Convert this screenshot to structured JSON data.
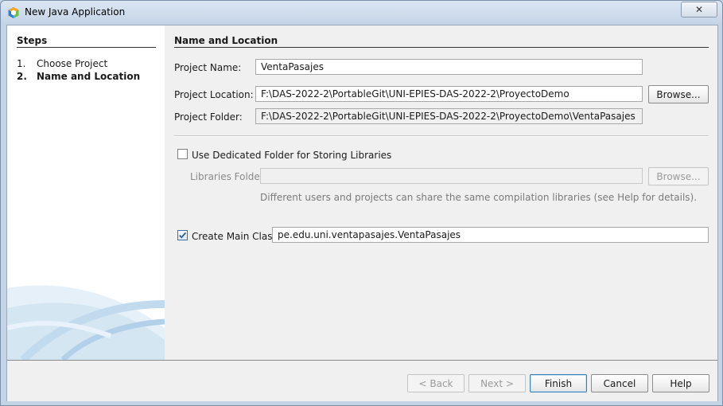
{
  "window": {
    "title": "New Java Application",
    "close_label": "✕"
  },
  "steps": {
    "title": "Steps",
    "items": [
      {
        "num": "1.",
        "label": "Choose Project",
        "current": false
      },
      {
        "num": "2.",
        "label": "Name and Location",
        "current": true
      }
    ]
  },
  "main": {
    "section_title": "Name and Location",
    "project_name": {
      "label": "Project Name:",
      "value": "VentaPasajes"
    },
    "project_location": {
      "label": "Project Location:",
      "value": "F:\\DAS-2022-2\\PortableGit\\UNI-EPIES-DAS-2022-2\\ProyectoDemo",
      "browse_label": "Browse..."
    },
    "project_folder": {
      "label": "Project Folder:",
      "value": "F:\\DAS-2022-2\\PortableGit\\UNI-EPIES-DAS-2022-2\\ProyectoDemo\\VentaPasajes"
    },
    "dedicated_folder": {
      "label": "Use Dedicated Folder for Storing Libraries",
      "checked": false
    },
    "libraries_folder": {
      "label": "Libraries Folder:",
      "value": "",
      "browse_label": "Browse..."
    },
    "libraries_hint": "Different users and projects can share the same compilation libraries (see Help for details).",
    "create_main_class": {
      "label": "Create Main Class",
      "checked": true,
      "value": "pe.edu.uni.ventapasajes.VentaPasajes"
    }
  },
  "buttons": {
    "back": "< Back",
    "next": "Next >",
    "finish": "Finish",
    "cancel": "Cancel",
    "help": "Help"
  }
}
